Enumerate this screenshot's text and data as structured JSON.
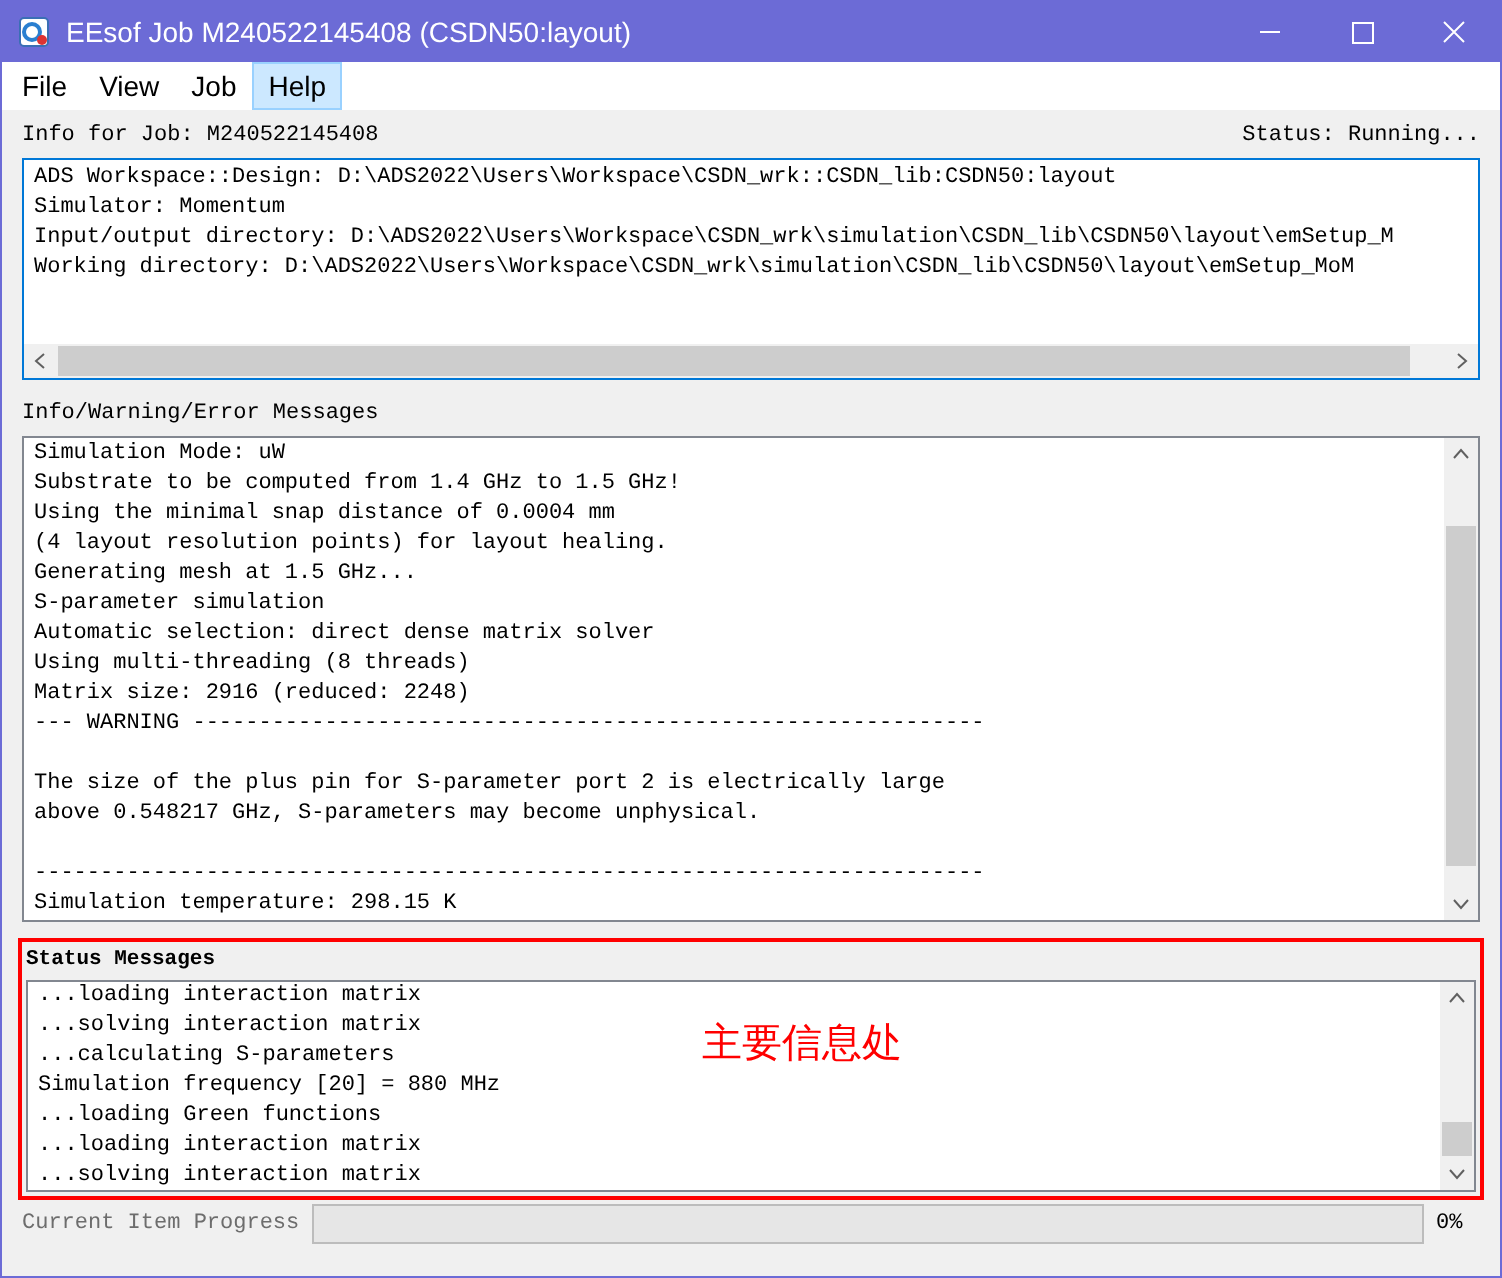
{
  "window": {
    "title": "EEsof Job M240522145408 (CSDN50:layout)"
  },
  "menu": [
    {
      "label": "File",
      "selected": false
    },
    {
      "label": "View",
      "selected": false
    },
    {
      "label": "Job",
      "selected": false
    },
    {
      "label": "Help",
      "selected": true
    }
  ],
  "job_info": {
    "label": "Info for Job: M240522145408",
    "status": "Status: Running...",
    "lines": [
      "ADS Workspace::Design: D:\\ADS2022\\Users\\Workspace\\CSDN_wrk::CSDN_lib:CSDN50:layout",
      "Simulator: Momentum",
      "Input/output directory: D:\\ADS2022\\Users\\Workspace\\CSDN_wrk\\simulation\\CSDN_lib\\CSDN50\\layout\\emSetup_M",
      "Working directory: D:\\ADS2022\\Users\\Workspace\\CSDN_wrk\\simulation\\CSDN_lib\\CSDN50\\layout\\emSetup_MoM"
    ]
  },
  "messages": {
    "label": "Info/Warning/Error Messages",
    "paragraphs": [
      [
        "Simulation Mode: uW",
        "Substrate to be computed from 1.4 GHz to 1.5 GHz!",
        "Using the minimal snap distance of 0.0004 mm",
        "(4 layout resolution points) for layout healing.",
        "Generating mesh at 1.5 GHz...",
        "S-parameter simulation",
        "Automatic selection: direct dense matrix solver",
        "Using multi-threading (8 threads)",
        "Matrix size: 2916 (reduced: 2248)",
        "--- WARNING ------------------------------------------------------------"
      ],
      [
        "The size of the plus pin for S-parameter port 2 is electrically large",
        "above 0.548217 GHz, S-parameters may become unphysical."
      ],
      [
        "------------------------------------------------------------------------",
        "Simulation temperature: 298.15 K"
      ]
    ]
  },
  "status_messages": {
    "label": "Status Messages",
    "lines": [
      "...loading interaction matrix",
      "...solving interaction matrix",
      "...calculating S-parameters",
      "Simulation frequency [20] = 880 MHz",
      "...loading Green functions",
      "...loading interaction matrix",
      "...solving interaction matrix"
    ],
    "annotation": "主要信息处"
  },
  "progress": {
    "label": "Current Item Progress",
    "level": 0,
    "reading": "0%"
  }
}
